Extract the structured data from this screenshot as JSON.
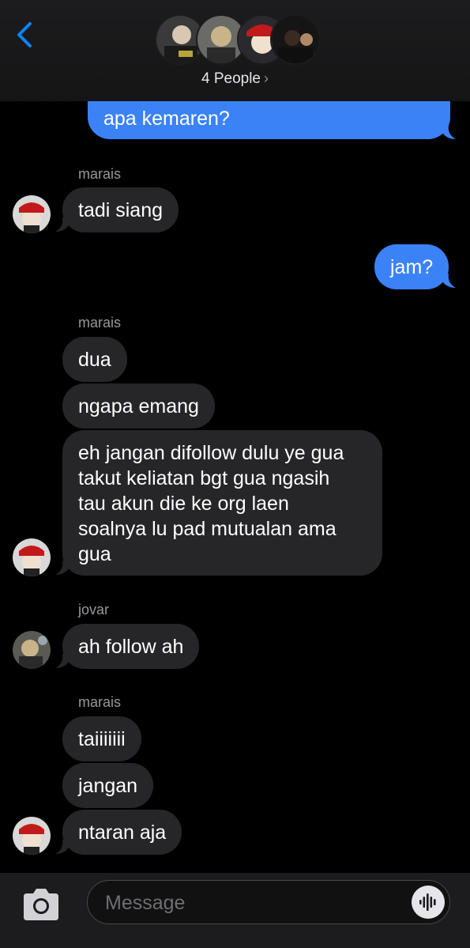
{
  "header": {
    "people_label": "4 People",
    "chevron": "›",
    "avatars": [
      "group-member-1",
      "group-member-2",
      "group-member-3",
      "group-member-4"
    ]
  },
  "messages": [
    {
      "id": "m0",
      "sender": "me",
      "text": "apa kemaren?"
    },
    {
      "id": "m1",
      "sender": "marais",
      "text": "tadi siang"
    },
    {
      "id": "m2",
      "sender": "me",
      "text": "jam?"
    },
    {
      "id": "m3",
      "sender": "marais",
      "text": "dua"
    },
    {
      "id": "m4",
      "sender": "marais",
      "text": "ngapa emang"
    },
    {
      "id": "m5",
      "sender": "marais",
      "lines": [
        "eh jangan difollow dulu ye gua",
        "takut keliatan bgt gua ngasih",
        "tau akun die ke org laen",
        "soalnya lu pad mutualan ama",
        "gua"
      ]
    },
    {
      "id": "m6",
      "sender": "jovar",
      "text": "ah follow ah"
    },
    {
      "id": "m7",
      "sender": "marais",
      "text": "taiiiiiii"
    },
    {
      "id": "m8",
      "sender": "marais",
      "text": "jangan"
    },
    {
      "id": "m9",
      "sender": "marais",
      "text": "ntaran aja"
    }
  ],
  "sender_names": {
    "s1": "marais",
    "s2": "marais",
    "s3": "jovar",
    "s4": "marais"
  },
  "composer": {
    "placeholder": "Message"
  },
  "colors": {
    "outgoing": "#3b82f6",
    "incoming": "#262628",
    "accent": "#0a84ff"
  }
}
